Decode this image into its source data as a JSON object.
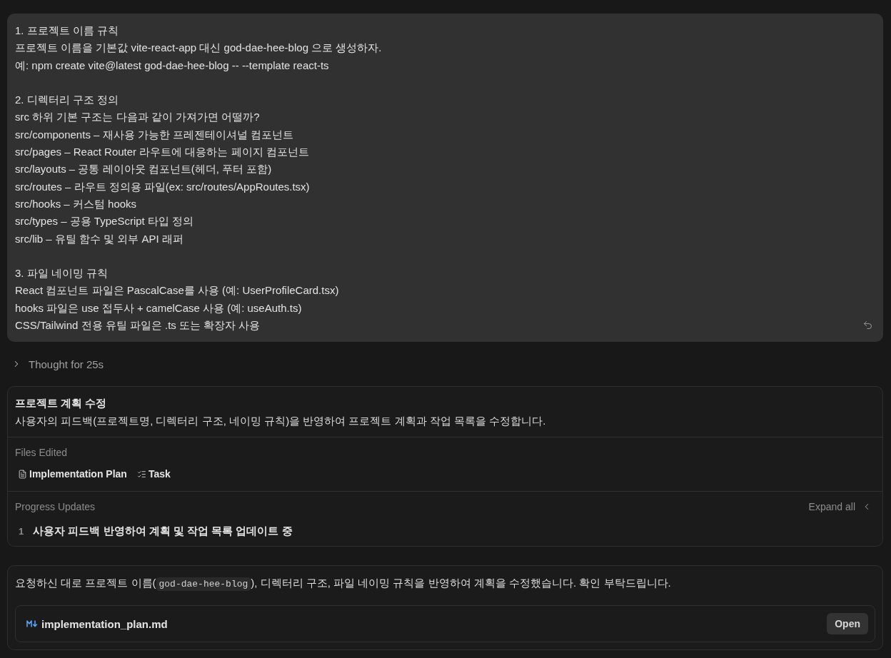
{
  "user_message": {
    "sections": [
      {
        "heading": "1. 프로젝트 이름 규칙",
        "lines": [
          "프로젝트 이름을 기본값 vite-react-app 대신 god-dae-hee-blog 으로 생성하자.",
          "예: npm create vite@latest god-dae-hee-blog -- --template react-ts"
        ]
      },
      {
        "heading": "2. 디렉터리 구조 정의",
        "lines": [
          "src 하위 기본 구조는 다음과 같이 가져가면 어떨까?",
          "src/components – 재사용 가능한 프레젠테이셔널 컴포넌트",
          "src/pages – React Router 라우트에 대응하는 페이지 컴포넌트",
          "src/layouts – 공통 레이아웃 컴포넌트(헤더, 푸터 포함)",
          "src/routes – 라우트 정의용 파일(ex: src/routes/AppRoutes.tsx)",
          "src/hooks – 커스텀 hooks",
          "src/types – 공용 TypeScript 타입 정의",
          "src/lib – 유틸 함수 및 외부 API 래퍼"
        ]
      },
      {
        "heading": "3. 파일 네이밍 규칙",
        "lines": [
          "React 컴포넌트 파일은 PascalCase를 사용 (예: UserProfileCard.tsx)",
          "hooks 파일은 use 접두사 + camelCase 사용 (예: useAuth.ts)",
          "CSS/Tailwind 전용 유틸 파일은 .ts 또는 확장자 사용"
        ]
      }
    ]
  },
  "thought": {
    "label": "Thought for 25s",
    "expanded": false
  },
  "task_card": {
    "title": "프로젝트 계획 수정",
    "description": "사용자의 피드백(프로젝트명, 디렉터리 구조, 네이밍 규칙)을 반영하여 프로젝트 계획과 작업 목록을 수정합니다.",
    "files_edited": {
      "label": "Files Edited",
      "files": [
        {
          "kind": "document",
          "name": "Implementation Plan"
        },
        {
          "kind": "checklist",
          "name": "Task"
        }
      ]
    },
    "progress": {
      "label": "Progress Updates",
      "expand_label": "Expand all",
      "steps": [
        {
          "number": "1",
          "text": "사용자 피드백 반영하여 계획 및 작업 목록 업데이트 중"
        }
      ]
    }
  },
  "response": {
    "segments": [
      {
        "kind": "text",
        "text": "요청하신 대로 프로젝트 이름("
      },
      {
        "kind": "code",
        "text": "god-dae-hee-blog"
      },
      {
        "kind": "text",
        "text": "), 디렉터리 구조, 파일 네이밍 규칙을 반영하여 계획을 수정했습니다. 확인 부탁드립니다."
      }
    ],
    "attachment": {
      "kind": "markdown",
      "filename": "implementation_plan.md",
      "button": "Open"
    }
  }
}
